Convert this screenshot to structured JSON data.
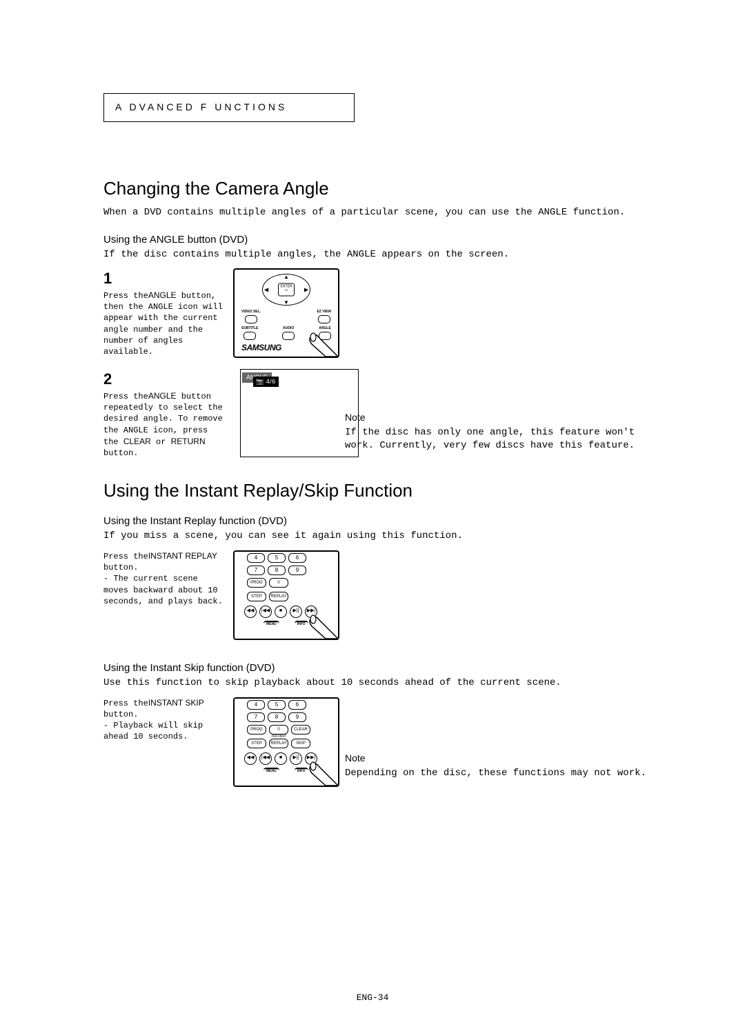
{
  "section_header": "A DVANCED  F UNCTIONS",
  "h1_angle": "Changing the Camera Angle",
  "intro_angle": "When a DVD contains multiple angles of a particular scene, you can use the ANGLE function.",
  "sub_angle": "Using the ANGLE button (DVD)",
  "sub_angle_text": "If the disc contains multiple angles, the ANGLE appears on the screen.",
  "step1_num": "1",
  "step1_pre": "Press the",
  "step1_btn": "ANGLE",
  "step1_post": " button, then the ANGLE icon will appear with the current angle number and the number of angles available.",
  "step2_num": "2",
  "step2_pre": "Press the",
  "step2_btn": "ANGLE",
  "step2_mid": " button repeatedly to select the desired angle. To remove the ANGLE icon, press the",
  "step2_btn2": "CLEAR",
  "step2_or": " or",
  "step2_btn3": "RETURN",
  "step2_post": " button.",
  "note1_label": "Note",
  "note1_text": "If the disc has only one angle, this feature won't work. Currently, very few discs have this feature.",
  "h1_instant": "Using the Instant Replay/Skip Function",
  "sub_replay": "Using the Instant Replay function (DVD)",
  "sub_replay_text": "If you miss a scene, you can see it again using this function.",
  "replay_pre": "Press the",
  "replay_btn": "INSTANT REPLAY",
  "replay_post": " button.",
  "replay_bullet": "- The current scene moves backward about 10 seconds, and plays back.",
  "sub_skip": "Using the Instant Skip function (DVD)",
  "sub_skip_text": "Use this function to skip playback about 10 seconds ahead of the current scene.",
  "skip_pre": "Press the",
  "skip_btn": "INSTANT SKIP",
  "skip_post": " button.",
  "skip_bullet": "- Playback will skip ahead 10 seconds.",
  "note2_label": "Note",
  "note2_text": "Depending on the disc, these functions may not work.",
  "page_num": "ENG-34",
  "osd_angle_icon": "📷",
  "osd_angle_frac": "4/6",
  "osd_angle_word": "ANGLE",
  "brand": "SAMSUNG",
  "remote": {
    "enter": "ENTER",
    "video_sel": "VIDEO SEL.",
    "ez_view": "EZ VIEW",
    "subtitle": "SUBTITLE",
    "audio": "AUDIO",
    "angle": "ANGLE",
    "prog": "PROG",
    "clear": "CLEAR",
    "step": "STEP",
    "replay": "REPLAY",
    "skip": "SKIP",
    "instant": "INSTANT",
    "menu": "MENU",
    "info": "INFO",
    "keys_top": [
      "4",
      "5",
      "6"
    ],
    "keys_mid": [
      "7",
      "8",
      "9"
    ],
    "key_zero": "0"
  }
}
